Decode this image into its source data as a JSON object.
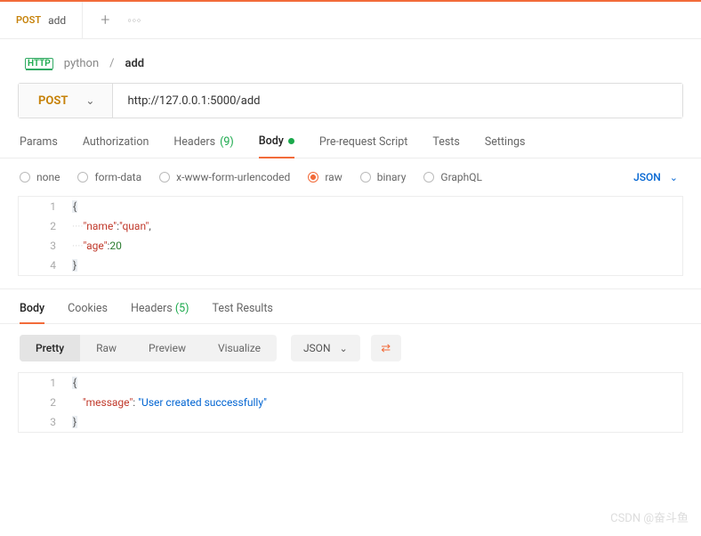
{
  "tab": {
    "method": "POST",
    "title": "add"
  },
  "tabActions": {
    "plus": "+",
    "more": "○○○"
  },
  "breadcrumb": {
    "badge": "HTTP",
    "collection": "python",
    "sep": "/",
    "name": "add"
  },
  "urlBar": {
    "method": "POST",
    "url": "http://127.0.0.1:5000/add"
  },
  "reqTabs": {
    "params": "Params",
    "auth": "Authorization",
    "headers": "Headers",
    "headersCount": "(9)",
    "body": "Body",
    "prereq": "Pre-request Script",
    "tests": "Tests",
    "settings": "Settings"
  },
  "bodyOpts": {
    "none": "none",
    "formdata": "form-data",
    "urlencoded": "x-www-form-urlencoded",
    "raw": "raw",
    "binary": "binary",
    "graphql": "GraphQL",
    "typeLabel": "JSON"
  },
  "reqBody": {
    "lines": [
      "1",
      "2",
      "3",
      "4"
    ],
    "key1": "\"name\"",
    "val1": "\"quan\"",
    "key2": "\"age\"",
    "val2": "20"
  },
  "respTabs": {
    "body": "Body",
    "cookies": "Cookies",
    "headers": "Headers",
    "headersCount": "(5)",
    "tests": "Test Results"
  },
  "viewBar": {
    "pretty": "Pretty",
    "raw": "Raw",
    "preview": "Preview",
    "visualize": "Visualize",
    "fmt": "JSON"
  },
  "respBody": {
    "lines": [
      "1",
      "2",
      "3"
    ],
    "key": "\"message\"",
    "val": "\"User created successfully\""
  },
  "watermark": "CSDN @奋斗鱼"
}
